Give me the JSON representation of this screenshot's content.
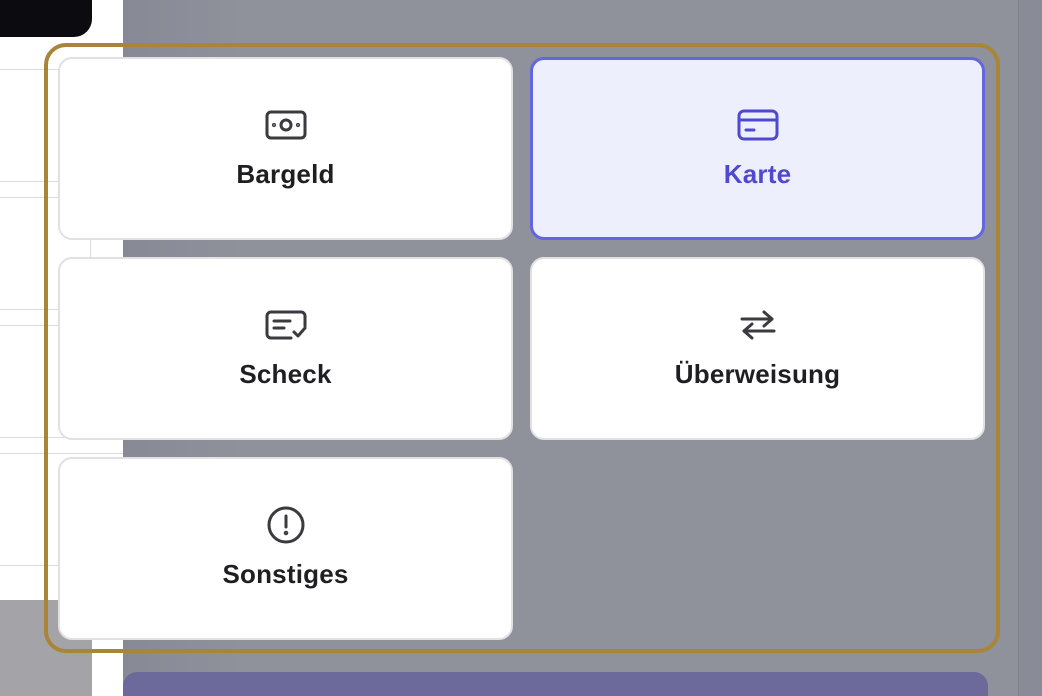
{
  "payment_methods": {
    "options": [
      {
        "key": "cash",
        "label": "Bargeld",
        "icon": "banknote-icon",
        "selected": false
      },
      {
        "key": "card",
        "label": "Karte",
        "icon": "credit-card-icon",
        "selected": true
      },
      {
        "key": "cheque",
        "label": "Scheck",
        "icon": "cheque-icon",
        "selected": false
      },
      {
        "key": "transfer",
        "label": "Überweisung",
        "icon": "transfer-arrows-icon",
        "selected": false
      },
      {
        "key": "other",
        "label": "Sonstiges",
        "icon": "exclamation-circle-icon",
        "selected": false
      }
    ]
  },
  "colors": {
    "selected_border": "#6366e0",
    "selected_text": "#5048d0",
    "selected_background": "#edf0fc",
    "highlight_frame": "#a88539",
    "overlay": "#8f919b",
    "primary_bar": "#6b6a9a"
  }
}
